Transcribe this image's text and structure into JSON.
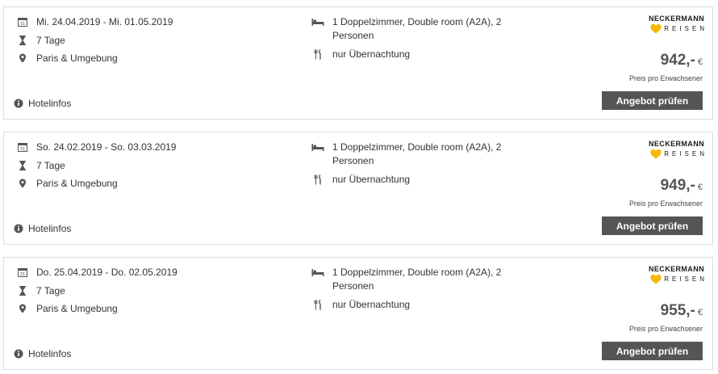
{
  "labels": {
    "hotelinfo": "Hotelinfos",
    "price_note": "Preis pro Erwachsener",
    "button": "Angebot prüfen",
    "brand_top": "NECKERMANN",
    "brand_bottom": "REISEN",
    "currency": "€"
  },
  "colors": {
    "button_bg": "#555555",
    "heart": "#f5b800",
    "border": "#dcdcdc"
  },
  "offers": [
    {
      "dates": "Mi. 24.04.2019 - Mi. 01.05.2019",
      "duration": "7 Tage",
      "location": "Paris & Umgebung",
      "room": "1 Doppelzimmer, Double room (A2A), 2 Personen",
      "board": "nur Übernachtung",
      "price": "942,-"
    },
    {
      "dates": "So. 24.02.2019 - So. 03.03.2019",
      "duration": "7 Tage",
      "location": "Paris & Umgebung",
      "room": "1 Doppelzimmer, Double room (A2A), 2 Personen",
      "board": "nur Übernachtung",
      "price": "949,-"
    },
    {
      "dates": "Do. 25.04.2019 - Do. 02.05.2019",
      "duration": "7 Tage",
      "location": "Paris & Umgebung",
      "room": "1 Doppelzimmer, Double room (A2A), 2 Personen",
      "board": "nur Übernachtung",
      "price": "955,-"
    }
  ]
}
